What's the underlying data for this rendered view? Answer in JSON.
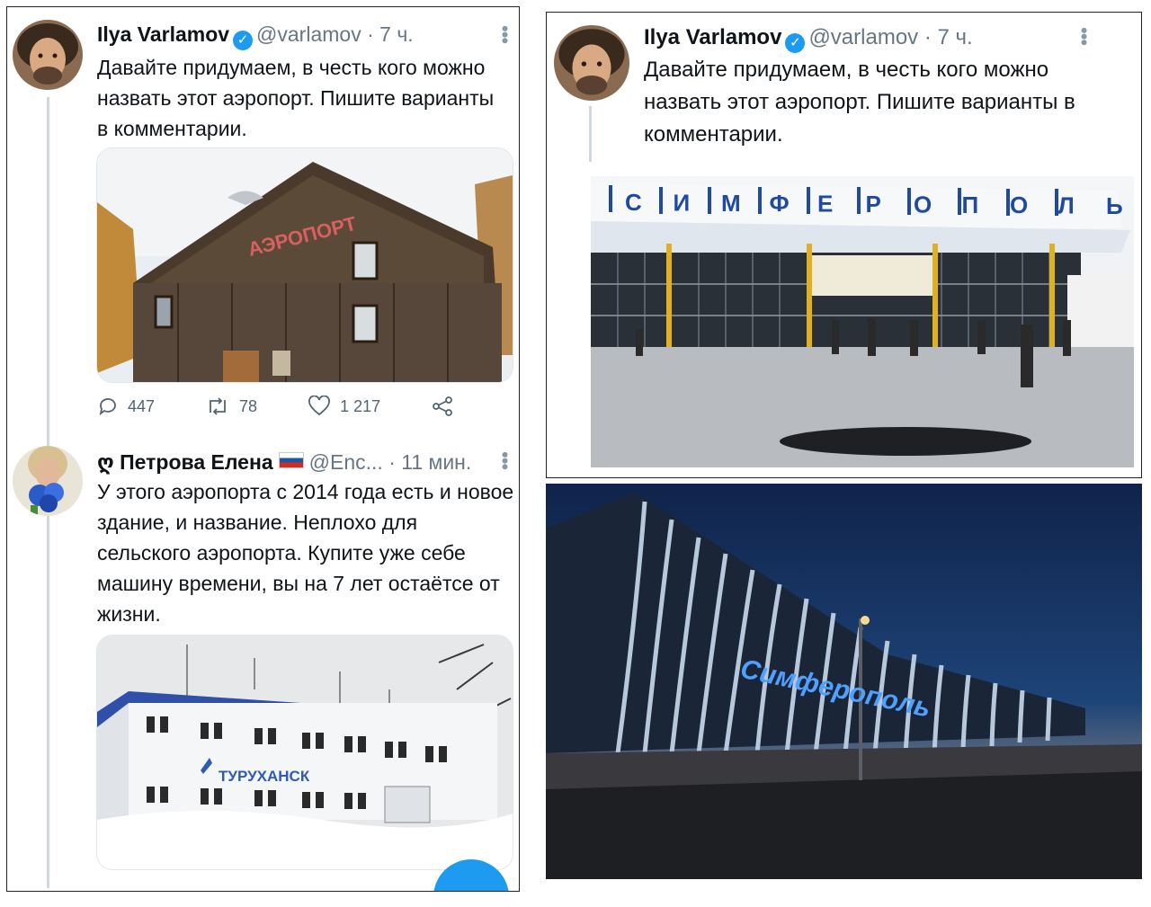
{
  "tweet_left": {
    "author_name": "Ilya Varlamov",
    "handle": "@varlamov",
    "time": "· 7 ч.",
    "text": "Давайте придумаем, в честь кого можно назвать этот аэропорт. Пишите варианты в комментарии.",
    "photo_sign": "АЭРОПОРТ",
    "stats": {
      "replies": "447",
      "retweets": "78",
      "likes": "1 217"
    }
  },
  "reply": {
    "author_prefix": "ღ",
    "author_name": "Петрова Елена",
    "handle": "@Enc...",
    "time": "· 11 мин.",
    "text": "У этого аэропорта с 2014 года есть и новое здание, и название. Неплохо для сельского аэропорта. Купите уже себе машину времени, вы на 7 лет остаётсе от жизни.",
    "photo_sign": "ТУРУХАНСК"
  },
  "tweet_right": {
    "author_name": "Ilya Varlamov",
    "handle": "@varlamov",
    "time": "· 7 ч.",
    "text": "Давайте придумаем, в честь кого можно назвать этот аэропорт. Пишите варианты в комментарии.",
    "photo_sign_letters": [
      "С",
      "И",
      "М",
      "Ф",
      "Е",
      "Р",
      "О",
      "П",
      "О",
      "Л",
      "Ь"
    ]
  },
  "new_terminal": {
    "sign": "Симферополь"
  },
  "colors": {
    "accent": "#1d9bf0",
    "muted": "#536471",
    "line": "#cfd9de"
  },
  "icons": {
    "reply": "reply-icon",
    "retweet": "retweet-icon",
    "like": "heart-icon",
    "share": "share-icon",
    "verified": "verified-badge-icon",
    "more": "more-icon"
  }
}
